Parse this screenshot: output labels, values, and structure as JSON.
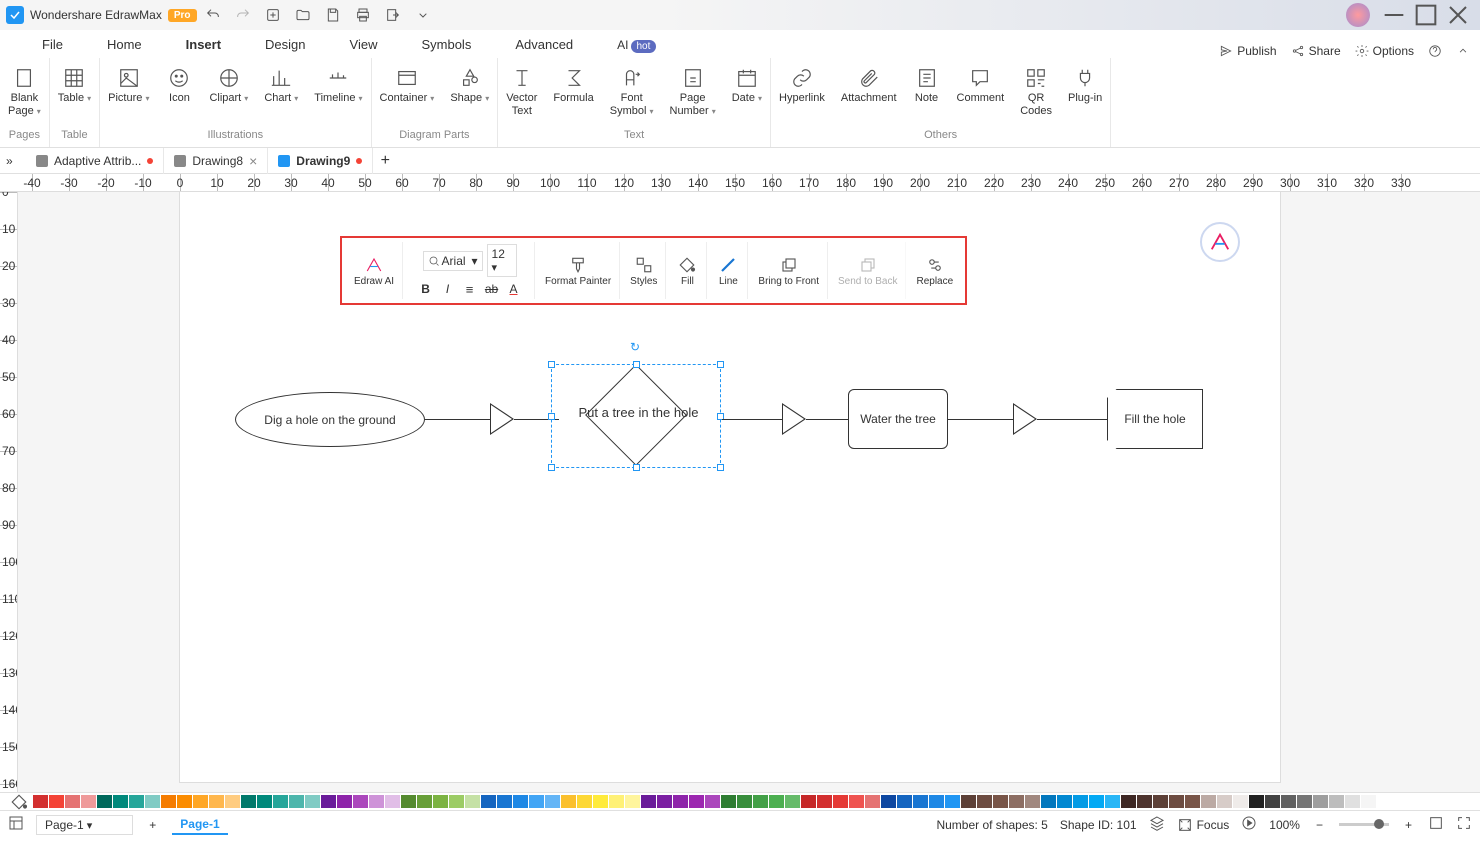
{
  "app": {
    "title": "Wondershare EdrawMax",
    "badge": "Pro"
  },
  "menu_tabs": [
    "File",
    "Home",
    "Insert",
    "Design",
    "View",
    "Symbols",
    "Advanced",
    "AI"
  ],
  "menu_active": "Insert",
  "ai_badge": "hot",
  "right_actions": {
    "publish": "Publish",
    "share": "Share",
    "options": "Options"
  },
  "ribbon": {
    "groups": [
      {
        "label": "Pages",
        "buttons": [
          {
            "name": "blank-page",
            "label": "Blank\nPage",
            "chev": true
          }
        ]
      },
      {
        "label": "Table",
        "buttons": [
          {
            "name": "table",
            "label": "Table",
            "chev": true
          }
        ]
      },
      {
        "label": "Illustrations",
        "buttons": [
          {
            "name": "picture",
            "label": "Picture",
            "chev": true
          },
          {
            "name": "icon",
            "label": "Icon"
          },
          {
            "name": "clipart",
            "label": "Clipart",
            "chev": true
          },
          {
            "name": "chart",
            "label": "Chart",
            "chev": true
          },
          {
            "name": "timeline",
            "label": "Timeline",
            "chev": true
          }
        ]
      },
      {
        "label": "Diagram Parts",
        "buttons": [
          {
            "name": "container",
            "label": "Container",
            "chev": true
          },
          {
            "name": "shape",
            "label": "Shape",
            "chev": true
          }
        ]
      },
      {
        "label": "Text",
        "buttons": [
          {
            "name": "vector-text",
            "label": "Vector\nText"
          },
          {
            "name": "formula",
            "label": "Formula"
          },
          {
            "name": "font-symbol",
            "label": "Font\nSymbol",
            "chev": true
          },
          {
            "name": "page-number",
            "label": "Page\nNumber",
            "chev": true
          },
          {
            "name": "date",
            "label": "Date",
            "chev": true
          }
        ]
      },
      {
        "label": "Others",
        "buttons": [
          {
            "name": "hyperlink",
            "label": "Hyperlink"
          },
          {
            "name": "attachment",
            "label": "Attachment"
          },
          {
            "name": "note",
            "label": "Note"
          },
          {
            "name": "comment",
            "label": "Comment"
          },
          {
            "name": "qr-codes",
            "label": "QR\nCodes"
          },
          {
            "name": "plugin",
            "label": "Plug-in"
          }
        ]
      }
    ]
  },
  "doc_tabs": [
    {
      "name": "Adaptive Attrib...",
      "modified": true,
      "active": false
    },
    {
      "name": "Drawing8",
      "modified": false,
      "active": false,
      "closable": true
    },
    {
      "name": "Drawing9",
      "modified": true,
      "active": true
    }
  ],
  "float_toolbar": {
    "ai": "Edraw AI",
    "font": "Arial",
    "size": "12",
    "format_painter": "Format\nPainter",
    "styles": "Styles",
    "fill": "Fill",
    "line": "Line",
    "bring_front": "Bring to\nFront",
    "send_back": "Send to\nBack",
    "replace": "Replace"
  },
  "shapes": {
    "s1": "Dig a hole on the ground",
    "s2": "Put a tree in the hole",
    "s3": "Water the tree",
    "s4": "Fill the hole"
  },
  "status": {
    "page_sel": "Page-1",
    "active_page": "Page-1",
    "shapes_count": "Number of shapes: 5",
    "shape_id": "Shape ID: 101",
    "focus": "Focus",
    "zoom": "100%"
  },
  "color_swatches": [
    "#d32f2f",
    "#f44336",
    "#e57373",
    "#ef9a9a",
    "#00695c",
    "#00897b",
    "#26a69a",
    "#80cbc4",
    "#f57c00",
    "#fb8c00",
    "#ffa726",
    "#ffb74d",
    "#ffcc80",
    "#00796b",
    "#00897b",
    "#26a69a",
    "#4db6ac",
    "#80cbc4",
    "#6a1b9a",
    "#8e24aa",
    "#ab47bc",
    "#ce93d8",
    "#e1bee7",
    "#558b2f",
    "#689f38",
    "#7cb342",
    "#9ccc65",
    "#c5e1a5",
    "#1565c0",
    "#1976d2",
    "#1e88e5",
    "#42a5f5",
    "#64b5f6",
    "#fbc02d",
    "#fdd835",
    "#ffeb3b",
    "#fff176",
    "#fff59d",
    "#6a1b9a",
    "#7b1fa2",
    "#8e24aa",
    "#9c27b0",
    "#ab47bc",
    "#2e7d32",
    "#388e3c",
    "#43a047",
    "#4caf50",
    "#66bb6a",
    "#c62828",
    "#d32f2f",
    "#e53935",
    "#ef5350",
    "#e57373",
    "#0d47a1",
    "#1565c0",
    "#1976d2",
    "#1e88e5",
    "#2196f3",
    "#5d4037",
    "#6d4c41",
    "#795548",
    "#8d6e63",
    "#a1887f",
    "#0277bd",
    "#0288d1",
    "#039be5",
    "#03a9f4",
    "#29b6f6",
    "#3e2723",
    "#4e342e",
    "#5d4037",
    "#6d4c41",
    "#795548",
    "#bcaaa4",
    "#d7ccc8",
    "#efebe9",
    "#212121",
    "#424242",
    "#616161",
    "#757575",
    "#9e9e9e",
    "#bdbdbd",
    "#e0e0e0",
    "#f5f5f5"
  ]
}
